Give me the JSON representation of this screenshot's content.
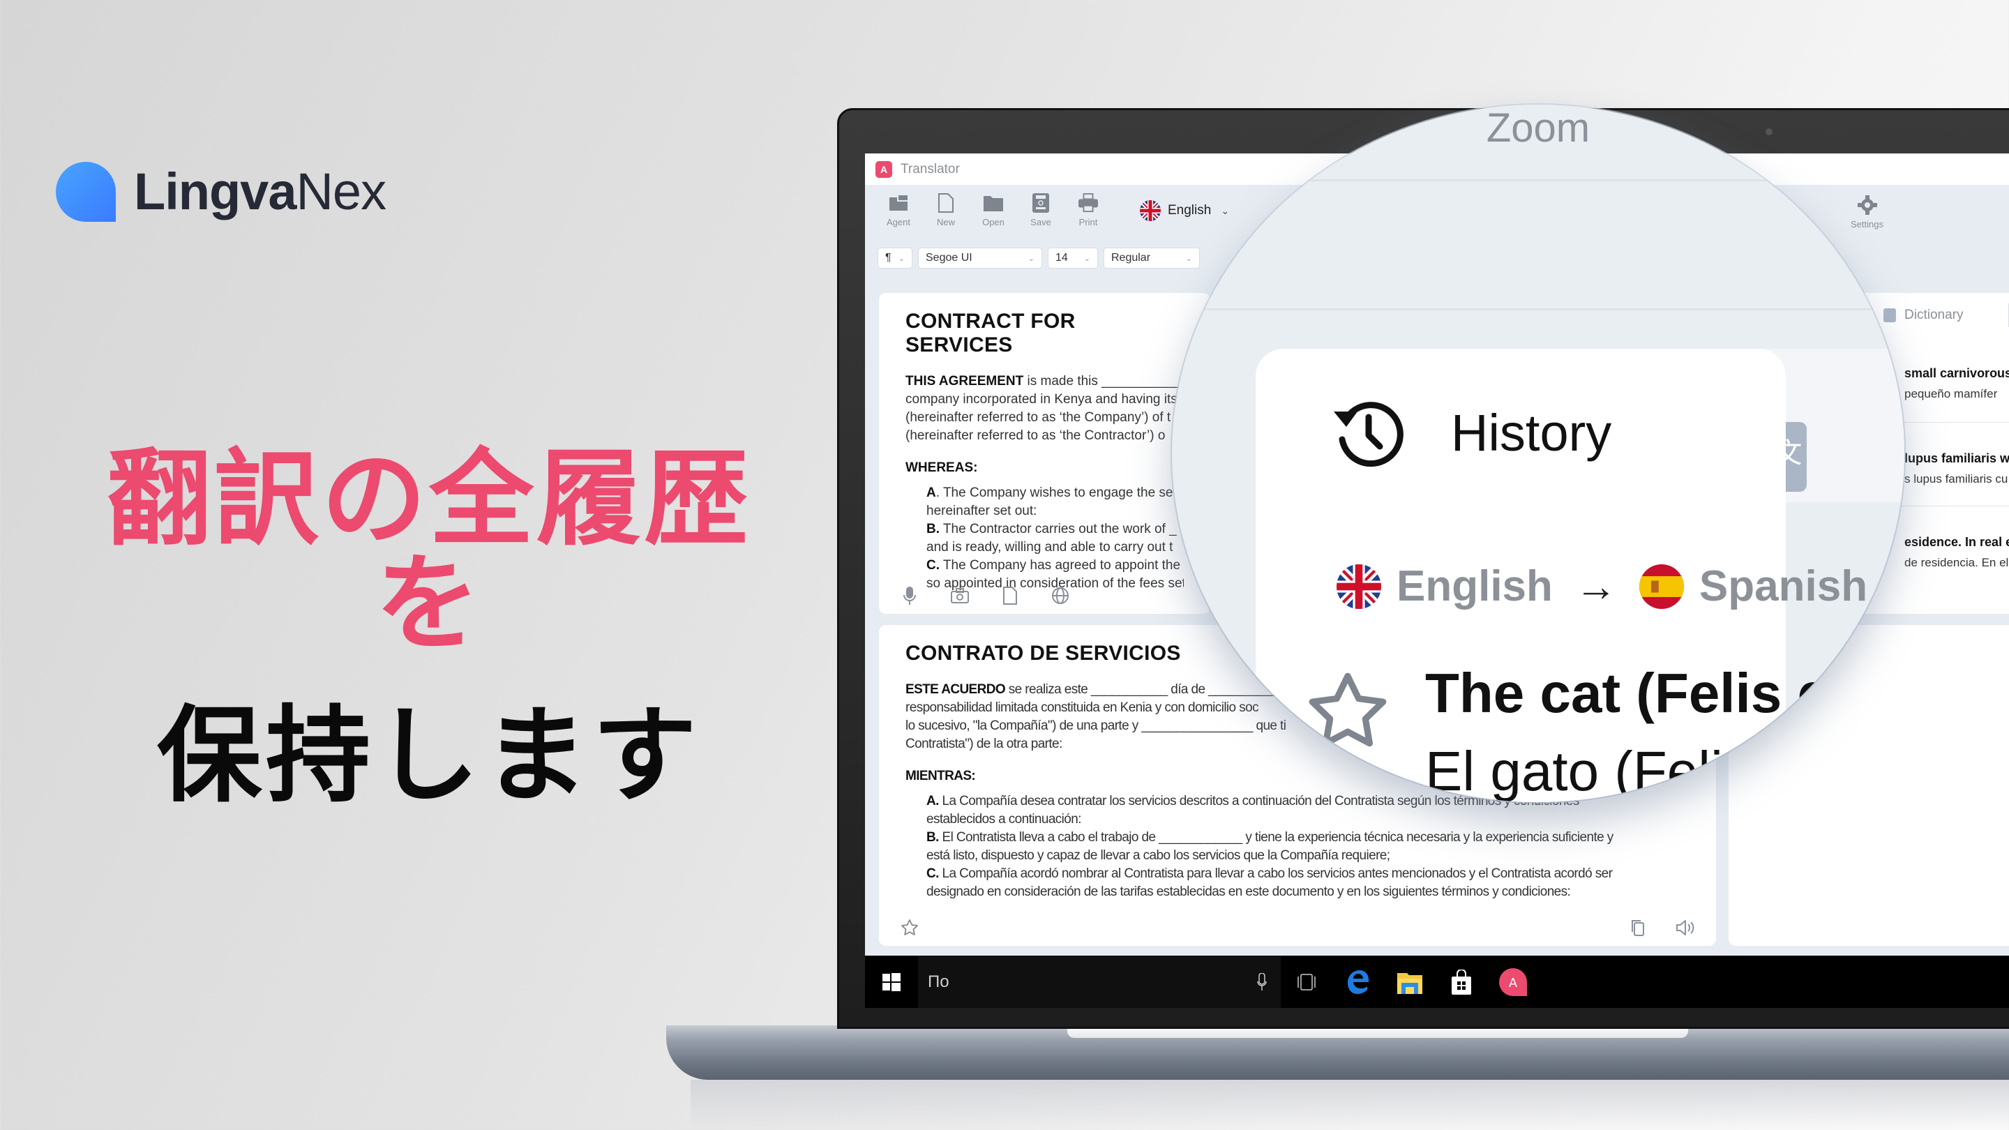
{
  "brand": {
    "logo_bold": "Lingva",
    "logo_light": "Nex",
    "logo_color": "#3a7bff"
  },
  "headline": {
    "line1": "翻訳の全履歴を",
    "line2": "保持します",
    "line1_color": "#ec4a6e",
    "line2_color": "#0a0a0a"
  },
  "app": {
    "window_title": "Translator",
    "toolbar": [
      {
        "icon": "agent-icon",
        "label": "Agent"
      },
      {
        "icon": "new-file-icon",
        "label": "New"
      },
      {
        "icon": "folder-icon",
        "label": "Open"
      },
      {
        "icon": "save-icon",
        "label": "Save"
      },
      {
        "icon": "print-icon",
        "label": "Print"
      }
    ],
    "language": "English",
    "settings_label": "Settings",
    "format": {
      "paragraph": "¶",
      "font": "Segoe UI",
      "size": "14",
      "weight": "Regular"
    },
    "source_doc": {
      "title": "CONTRACT FOR SERVICES",
      "intro_bold": "THIS AGREEMENT",
      "intro_lines": [
        " is made this ___________ d",
        "company incorporated in Kenya and having its",
        "(hereinafter referred to as ‘the Company’) of t",
        "(hereinafter referred to as ‘the Contractor’) o"
      ],
      "whereas": "WHEREAS:",
      "items": [
        {
          "letter": "A",
          "lines": [
            ". The Company wishes to engage the se",
            "hereinafter    set out:"
          ]
        },
        {
          "letter": "B.",
          "lines": [
            " The Contractor carries out the work of _",
            "and   is ready, willing and able to carry out t"
          ]
        },
        {
          "letter": "C.",
          "lines": [
            " The Company has agreed to appoint the",
            "so appointed in consideration of the fees set"
          ]
        }
      ],
      "tools": [
        "microphone-icon",
        "camera-icon",
        "document-icon",
        "globe-icon"
      ]
    },
    "target_doc": {
      "title": "CONTRATO DE SERVICIOS",
      "intro_bold": "ESTE ACUERDO",
      "intro_lines": [
        " se realiza este ___________ día de __________",
        "responsabilidad limitada constituida en Kenia y con domicilio soc",
        "lo sucesivo, \"la Compañía\") de una parte y ________________ que ti",
        "Contratista\") de la otra parte:"
      ],
      "whereas": "MIENTRAS:",
      "items": [
        {
          "letter": "A.",
          "lines": [
            " La Compañía desea contratar los servicios descritos a continuación del Contratista según los términos y condiciones",
            "establecidos    a continuación:"
          ]
        },
        {
          "letter": "B.",
          "lines": [
            " El Contratista lleva a cabo el trabajo de ____________ y tiene la experiencia técnica necesaria y la experiencia suficiente y",
            "está listo, dispuesto y capaz de llevar a cabo los servicios que la Compañía requiere;"
          ]
        },
        {
          "letter": "C.",
          "lines": [
            " La Compañía acordó nombrar al Contratista para llevar a cabo los servicios antes mencionados y el Contratista acordó ser",
            "designado en consideración de las tarifas establecidas en este documento y en los siguientes términos y condiciones:"
          ]
        }
      ]
    },
    "dictionary": {
      "tab_label": "Dictionary",
      "entries": [
        {
          "src": "small carnivorous",
          "tgt": "pequeño mamífer"
        },
        {
          "src": "lupus familiaris w",
          "tgt": "s lupus familiaris cu"
        },
        {
          "src": "esidence. In real esta",
          "tgt": "de residencia. En el us"
        }
      ]
    },
    "taskbar": {
      "search_text": "По",
      "icons": [
        "windows-start-icon",
        "microphone-icon",
        "task-view-icon",
        "edge-browser-icon",
        "file-explorer-icon",
        "store-icon",
        "lingvanex-app-icon"
      ]
    }
  },
  "magnifier": {
    "zoom_label": "Zoom",
    "panel_title": "History",
    "source_lang": "English",
    "target_lang": "Spanish",
    "arrow": "→",
    "source_text": "The cat (Felis catus)",
    "target_text": "El gato (Felis catus)"
  },
  "colors": {
    "accent_pink": "#ec4a6e",
    "app_bg": "#e7ecf2",
    "icon_gray": "#8a9099"
  }
}
